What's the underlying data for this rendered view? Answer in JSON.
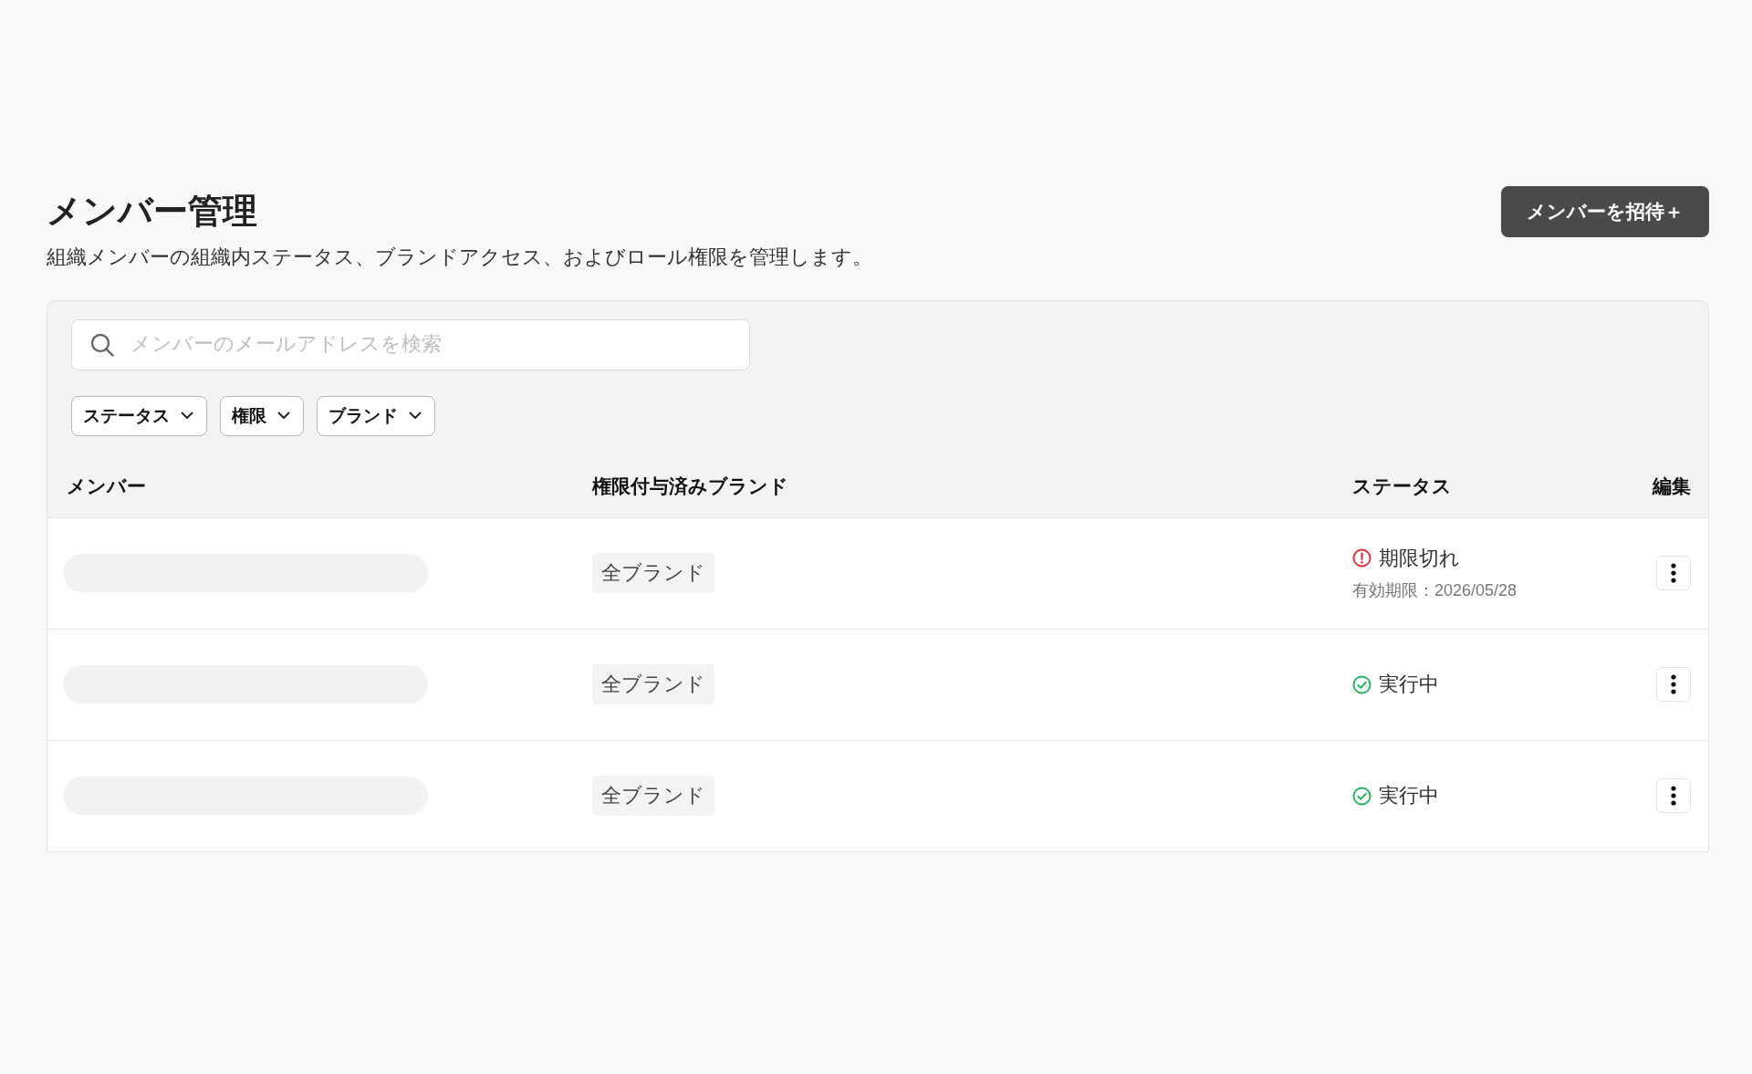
{
  "header": {
    "title": "メンバー管理",
    "description": "組織メンバーの組織内ステータス、ブランドアクセス、およびロール権限を管理します。",
    "invite_button": "メンバーを招待＋"
  },
  "search": {
    "placeholder": "メンバーのメールアドレスを検索"
  },
  "filters": [
    {
      "label": "ステータス"
    },
    {
      "label": "権限"
    },
    {
      "label": "ブランド"
    }
  ],
  "table": {
    "columns": [
      "メンバー",
      "権限付与済みブランド",
      "ステータス",
      "編集"
    ],
    "rows": [
      {
        "loading": true,
        "brands": "全ブランド",
        "status": {
          "kind": "expired",
          "label": "期限切れ",
          "note": "有効期限：2026/05/28"
        }
      },
      {
        "loading": true,
        "brands": "全ブランド",
        "status": {
          "kind": "active",
          "label": "実行中"
        }
      },
      {
        "loading": true,
        "brands": "全ブランド",
        "status": {
          "kind": "active",
          "label": "実行中"
        }
      }
    ]
  }
}
